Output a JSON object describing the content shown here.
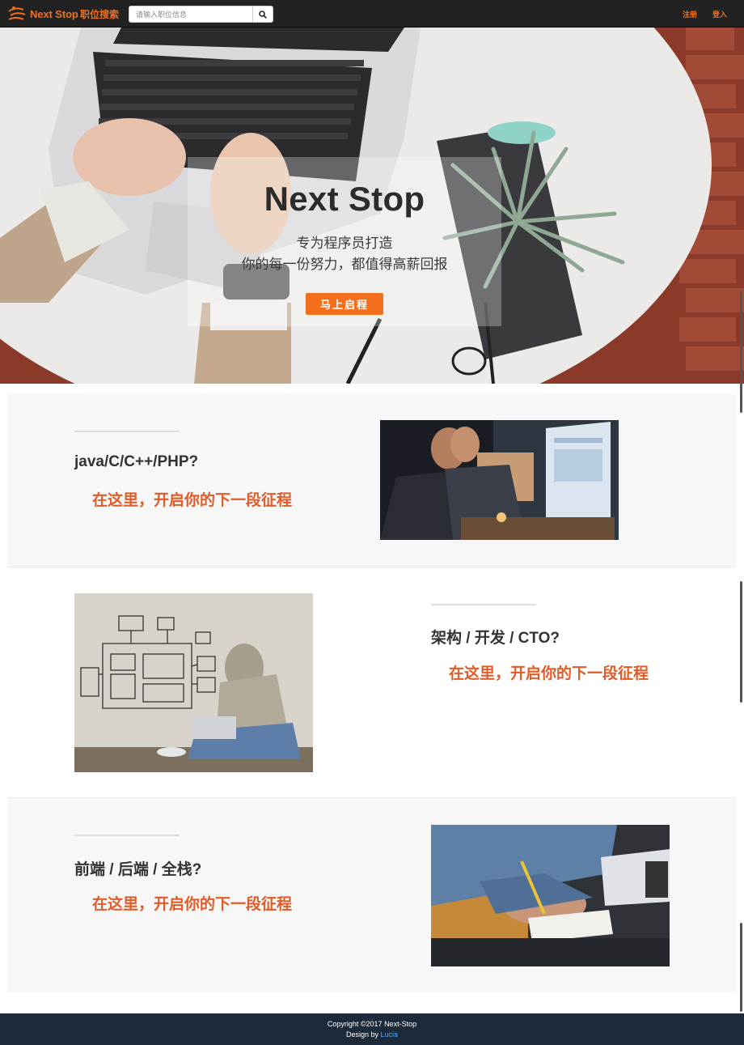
{
  "navbar": {
    "brand_name": "Next Stop",
    "search_link": "职位搜索",
    "search_placeholder": "请输入职位信息",
    "search_icon": "magnifier-icon",
    "register": "注册",
    "login": "登入",
    "accent_color": "#f36f1c"
  },
  "hero": {
    "title": "Next Stop",
    "subtitle_1": "专为程序员打造",
    "subtitle_2": "你的每一份努力，都值得高薪回报",
    "cta": "马上启程",
    "cta_color": "#f36f1c"
  },
  "features": [
    {
      "title": "java/C/C++/PHP?",
      "tagline": "在这里，开启你的下一段征程",
      "image": "developers-at-monitor-photo"
    },
    {
      "title": "架构 / 开发 / CTO?",
      "tagline": "在这里，开启你的下一段征程",
      "image": "architect-sketch-wall-photo"
    },
    {
      "title": "前端 / 后端 / 全栈?",
      "tagline": "在这里，开启你的下一段征程",
      "image": "writing-notes-laptop-photo"
    }
  ],
  "footer": {
    "copyright": "Copyright ©2017 Next-Stop",
    "design_by": "Design by",
    "author": "Lucia"
  }
}
